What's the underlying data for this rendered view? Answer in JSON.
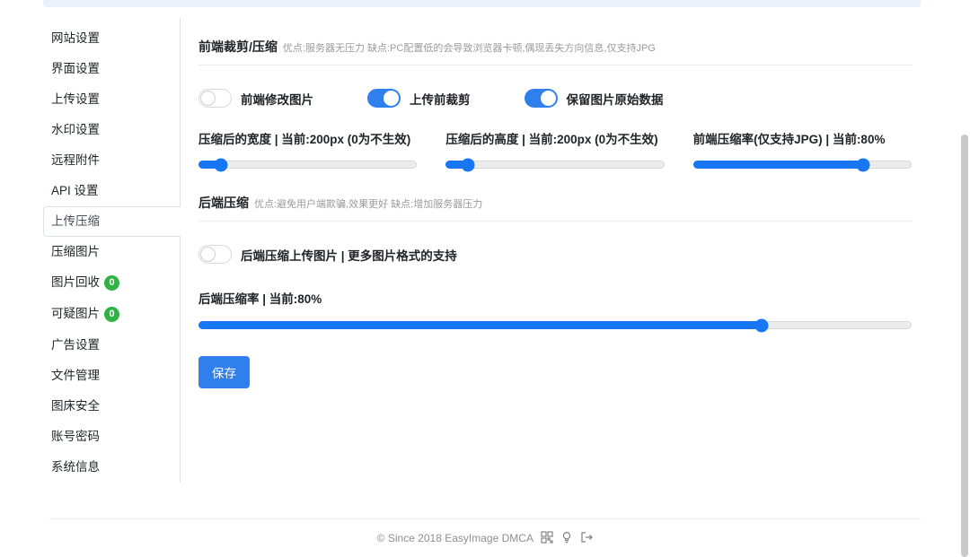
{
  "sidebar": {
    "items": [
      {
        "label": "网站设置"
      },
      {
        "label": "界面设置"
      },
      {
        "label": "上传设置"
      },
      {
        "label": "水印设置"
      },
      {
        "label": "远程附件"
      },
      {
        "label": "API 设置"
      },
      {
        "label": "上传压缩",
        "active": true
      },
      {
        "label": "压缩图片"
      },
      {
        "label": "图片回收",
        "badge": "0"
      },
      {
        "label": "可疑图片",
        "badge": "0"
      },
      {
        "label": "广告设置"
      },
      {
        "label": "文件管理"
      },
      {
        "label": "图床安全"
      },
      {
        "label": "账号密码"
      },
      {
        "label": "系统信息"
      }
    ]
  },
  "content": {
    "frontend": {
      "title": "前端裁剪/压缩",
      "desc": "优点:服务器无压力 缺点:PC配置低的会导致浏览器卡顿,偶现丢失方向信息,仅支持JPG",
      "toggles": [
        {
          "label": "前端修改图片",
          "on": false
        },
        {
          "label": "上传前裁剪",
          "on": true
        },
        {
          "label": "保留图片原始数据",
          "on": true
        }
      ],
      "sliders": [
        {
          "label": "压缩后的宽度 | 当前:200px (0为不生效)",
          "value_percent": 10
        },
        {
          "label": "压缩后的高度 | 当前:200px (0为不生效)",
          "value_percent": 10
        },
        {
          "label": "前端压缩率(仅支持JPG) | 当前:80%",
          "value_percent": 78
        }
      ]
    },
    "backend": {
      "title": "后端压缩",
      "desc": "优点:避免用户端欺骗,效果更好 缺点:增加服务器压力",
      "toggle": {
        "label": "后端压缩上传图片 | 更多图片格式的支持",
        "on": false
      },
      "slider": {
        "label": "后端压缩率 | 当前:80%",
        "value_percent": 79
      },
      "save_label": "保存"
    }
  },
  "footer": {
    "copyright": "© Since 2018 EasyImage",
    "dmca_label": "DMCA",
    "icons": [
      "qr-code-icon",
      "lightbulb-icon",
      "logout-icon"
    ]
  },
  "colors": {
    "accent_blue": "#2F80ED",
    "slider_blue": "#1676F3",
    "badge_green": "#2EB344",
    "top_strip": "#EBF1FB"
  }
}
